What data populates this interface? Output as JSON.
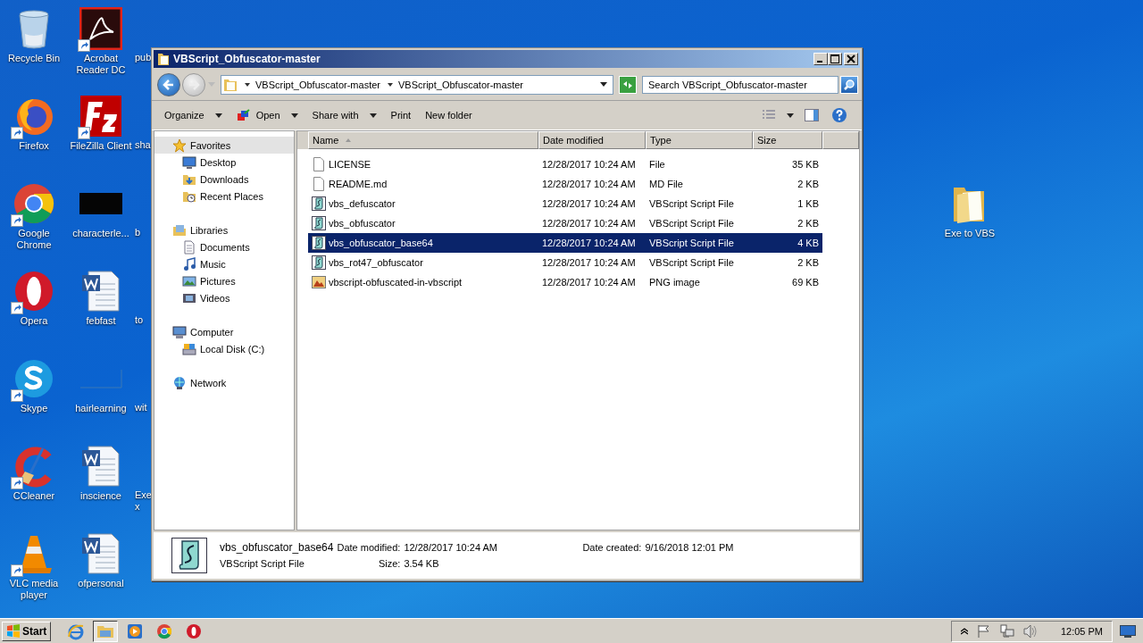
{
  "desktop": {
    "columns": [
      [
        {
          "label": "Recycle Bin",
          "kind": "recycle",
          "shortcut": false
        },
        {
          "label": "Firefox",
          "kind": "firefox",
          "shortcut": true
        },
        {
          "label": "Google Chrome",
          "kind": "chrome",
          "shortcut": true
        },
        {
          "label": "Opera",
          "kind": "opera",
          "shortcut": true
        },
        {
          "label": "Skype",
          "kind": "skype",
          "shortcut": true
        },
        {
          "label": "CCleaner",
          "kind": "ccleaner",
          "shortcut": true
        },
        {
          "label": "VLC media player",
          "kind": "vlc",
          "shortcut": true
        }
      ],
      [
        {
          "label": "Acrobat Reader DC",
          "kind": "acrobat",
          "shortcut": true
        },
        {
          "label": "FileZilla Client",
          "kind": "filezilla",
          "shortcut": true
        },
        {
          "label": "characterle...",
          "kind": "dark",
          "shortcut": false
        },
        {
          "label": "febfast",
          "kind": "word",
          "shortcut": false
        },
        {
          "label": "hairlearning",
          "kind": "blank",
          "shortcut": false
        },
        {
          "label": "inscience",
          "kind": "word",
          "shortcut": false
        },
        {
          "label": "ofpersonal",
          "kind": "word",
          "shortcut": false
        }
      ],
      [
        {
          "label": "pub",
          "kind": "cut"
        },
        {
          "label": "sha",
          "kind": "cut"
        },
        {
          "label": "b",
          "kind": "cut"
        },
        {
          "label": "to",
          "kind": "cut"
        },
        {
          "label": "wit",
          "kind": "cut"
        },
        {
          "label": "Exe x",
          "kind": "cut"
        }
      ]
    ],
    "right_icon": {
      "label": "Exe to VBS",
      "kind": "folder",
      "shortcut": false
    }
  },
  "window": {
    "title": "VBScript_Obfuscator-master",
    "address": [
      "VBScript_Obfuscator-master",
      "VBScript_Obfuscator-master"
    ],
    "search": {
      "placeholder": "Search VBScript_Obfuscator-master"
    },
    "toolbar": [
      {
        "label": "Organize",
        "kind": "menu"
      },
      {
        "label": "Open",
        "kind": "open"
      },
      {
        "label": "Share with",
        "kind": "menu"
      },
      {
        "label": "Print",
        "kind": "plain"
      },
      {
        "label": "New folder",
        "kind": "plain"
      }
    ],
    "nav": [
      {
        "label": "Favorites",
        "kind": "star",
        "selected": true,
        "children": [
          {
            "label": "Desktop",
            "kind": "desktop",
            "selected": false
          },
          {
            "label": "Downloads",
            "kind": "downloads",
            "selected": false
          },
          {
            "label": "Recent Places",
            "kind": "recent",
            "selected": false
          }
        ]
      },
      {
        "label": "Libraries",
        "kind": "library",
        "selected": false,
        "children": [
          {
            "label": "Documents",
            "kind": "documents",
            "selected": false
          },
          {
            "label": "Music",
            "kind": "music",
            "selected": false
          },
          {
            "label": "Pictures",
            "kind": "pictures",
            "selected": false
          },
          {
            "label": "Videos",
            "kind": "videos",
            "selected": false
          }
        ]
      },
      {
        "label": "Computer",
        "kind": "computer",
        "selected": false,
        "children": [
          {
            "label": "Local Disk (C:)",
            "kind": "disk",
            "selected": false
          }
        ]
      },
      {
        "label": "Network",
        "kind": "network",
        "selected": false
      }
    ],
    "table": {
      "columns": [
        {
          "label": "Name",
          "sorted": true
        },
        {
          "label": "Date modified",
          "sorted": false
        },
        {
          "label": "Type",
          "sorted": false
        },
        {
          "label": "Size",
          "sorted": false
        }
      ],
      "rows": [
        {
          "name": "LICENSE",
          "date": "12/28/2017 10:24 AM",
          "type": "File",
          "size": "35 KB",
          "kind": "document",
          "selected": false
        },
        {
          "name": "README.md",
          "date": "12/28/2017 10:24 AM",
          "type": "MD File",
          "size": "2 KB",
          "kind": "document",
          "selected": false
        },
        {
          "name": "vbs_defuscator",
          "date": "12/28/2017 10:24 AM",
          "type": "VBScript Script File",
          "size": "1 KB",
          "kind": "script",
          "selected": false
        },
        {
          "name": "vbs_obfuscator",
          "date": "12/28/2017 10:24 AM",
          "type": "VBScript Script File",
          "size": "2 KB",
          "kind": "script",
          "selected": false
        },
        {
          "name": "vbs_obfuscator_base64",
          "date": "12/28/2017 10:24 AM",
          "type": "VBScript Script File",
          "size": "4 KB",
          "kind": "script",
          "selected": true
        },
        {
          "name": "vbs_rot47_obfuscator",
          "date": "12/28/2017 10:24 AM",
          "type": "VBScript Script File",
          "size": "2 KB",
          "kind": "script",
          "selected": false
        },
        {
          "name": "vbscript-obfuscated-in-vbscript",
          "date": "12/28/2017 10:24 AM",
          "type": "PNG image",
          "size": "69 KB",
          "kind": "image",
          "selected": false
        }
      ]
    },
    "details": {
      "name": "vbs_obfuscator_base64",
      "type": "VBScript Script File",
      "modified_label": "Date modified:",
      "modified": "12/28/2017 10:24 AM",
      "created_label": "Date created:",
      "created": "9/16/2018 12:01 PM",
      "size_label": "Size:",
      "size": "3.54 KB"
    }
  },
  "taskbar": {
    "start": "Start",
    "apps": [
      {
        "kind": "ie",
        "active": false
      },
      {
        "kind": "explorer",
        "active": true
      },
      {
        "kind": "media",
        "active": false
      },
      {
        "kind": "chrome",
        "active": false
      },
      {
        "kind": "opera",
        "active": false
      }
    ],
    "clock": "12:05 PM"
  }
}
